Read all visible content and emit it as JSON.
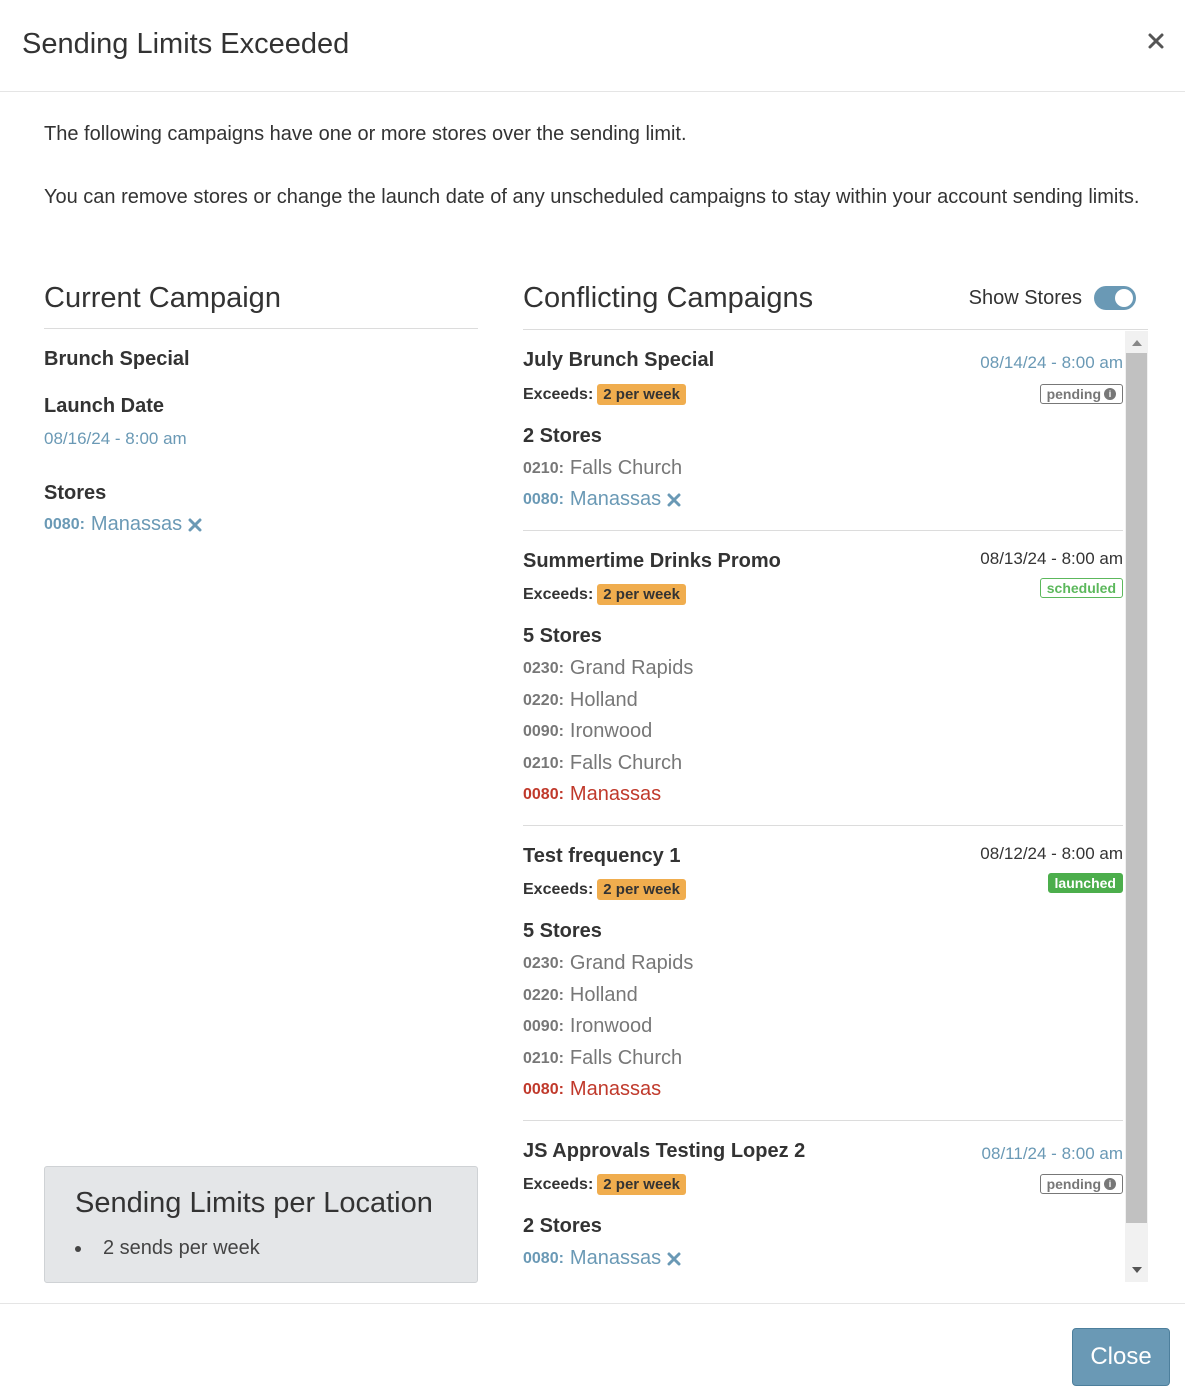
{
  "modal": {
    "title": "Sending Limits Exceeded",
    "intro_1": "The following campaigns have one or more stores over the sending limit.",
    "intro_2": "You can remove stores or change the launch date of any unscheduled campaigns to stay within your account sending limits.",
    "close_label": "Close"
  },
  "current": {
    "heading": "Current Campaign",
    "name": "Brunch Special",
    "launch_label": "Launch Date",
    "launch_date": "08/16/24 - 8:00 am",
    "stores_label": "Stores",
    "store_code": "0080:",
    "store_name": "Manassas"
  },
  "limits": {
    "title": "Sending Limits per Location",
    "item": "2 sends per week"
  },
  "conflicting": {
    "heading": "Conflicting Campaigns",
    "show_stores_label": "Show Stores",
    "show_stores_on": true,
    "exceeds_label": "Exceeds:",
    "campaigns": [
      {
        "name": "July Brunch Special",
        "date": "08/14/24 - 8:00 am",
        "exceeds": "2 per week",
        "status": "pending",
        "stores_count": "2 Stores",
        "stores": [
          {
            "code": "0210:",
            "name": "Falls Church"
          },
          {
            "code": "0080:",
            "name": "Manassas"
          }
        ]
      },
      {
        "name": "Summertime Drinks Promo",
        "date": "08/13/24 - 8:00 am",
        "exceeds": "2 per week",
        "status": "scheduled",
        "stores_count": "5 Stores",
        "stores": [
          {
            "code": "0230:",
            "name": "Grand Rapids"
          },
          {
            "code": "0220:",
            "name": "Holland"
          },
          {
            "code": "0090:",
            "name": "Ironwood"
          },
          {
            "code": "0210:",
            "name": "Falls Church"
          },
          {
            "code": "0080:",
            "name": "Manassas"
          }
        ]
      },
      {
        "name": "Test frequency 1",
        "date": "08/12/24 - 8:00 am",
        "exceeds": "2 per week",
        "status": "launched",
        "stores_count": "5 Stores",
        "stores": [
          {
            "code": "0230:",
            "name": "Grand Rapids"
          },
          {
            "code": "0220:",
            "name": "Holland"
          },
          {
            "code": "0090:",
            "name": "Ironwood"
          },
          {
            "code": "0210:",
            "name": "Falls Church"
          },
          {
            "code": "0080:",
            "name": "Manassas"
          }
        ]
      },
      {
        "name": "JS Approvals Testing Lopez 2",
        "date": "08/11/24 - 8:00 am",
        "exceeds": "2 per week",
        "status": "pending",
        "stores_count": "2 Stores",
        "stores": [
          {
            "code": "0080:",
            "name": "Manassas"
          }
        ]
      }
    ]
  },
  "colors": {
    "accent": "#6a99b5",
    "warning": "#f0ad4e",
    "danger": "#c0392b",
    "success": "#4cae4c"
  }
}
